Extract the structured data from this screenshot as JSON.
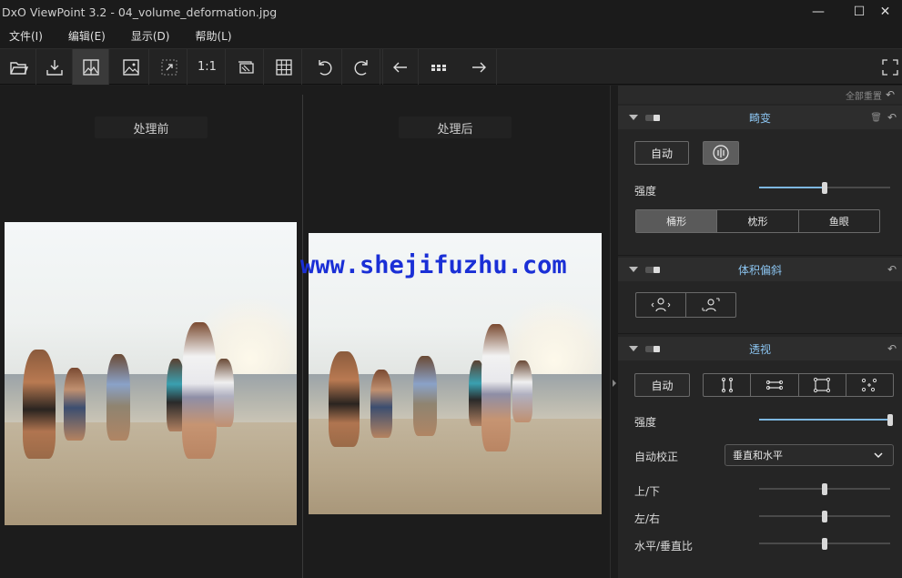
{
  "window": {
    "title": "DxO ViewPoint 3.2 - 04_volume_deformation.jpg",
    "minimize": "—",
    "maximize": "☐",
    "close": "✕"
  },
  "menu": [
    "文件(I)",
    "编辑(E)",
    "显示(D)",
    "帮助(L)"
  ],
  "toolbar": {
    "zoom_label": "1:1",
    "icons": [
      "folder-open-icon",
      "export-icon",
      "before-after-icon",
      "single-image-icon",
      "fit-screen-icon",
      "zoom-100-icon",
      "mask-icon",
      "grid-icon",
      "rotate-left-icon",
      "rotate-right-icon",
      "prev-arrow-icon",
      "grid-view-icon",
      "next-arrow-icon",
      "fullscreen-icon"
    ]
  },
  "viewer": {
    "before_label": "处理前",
    "after_label": "处理后",
    "watermark": "www.shejifuzhu.com"
  },
  "panel": {
    "reset_all": "全部重置",
    "distortion": {
      "title": "畸变",
      "auto_button": "自动",
      "strength_label": "强度",
      "strength_value": 0.5,
      "types": [
        "桶形",
        "枕形",
        "鱼眼"
      ],
      "active_type": "桶形"
    },
    "volume": {
      "title": "体积偏斜"
    },
    "perspective": {
      "title": "透视",
      "auto_button": "自动",
      "strength_label": "强度",
      "strength_value": 1.0,
      "auto_correct_label": "自动校正",
      "auto_correct_value": "垂直和水平",
      "up_down_label": "上/下",
      "up_down_value": 0.5,
      "left_right_label": "左/右",
      "left_right_value": 0.5,
      "ratio_label": "水平/垂直比",
      "ratio_value": 0.5
    }
  }
}
